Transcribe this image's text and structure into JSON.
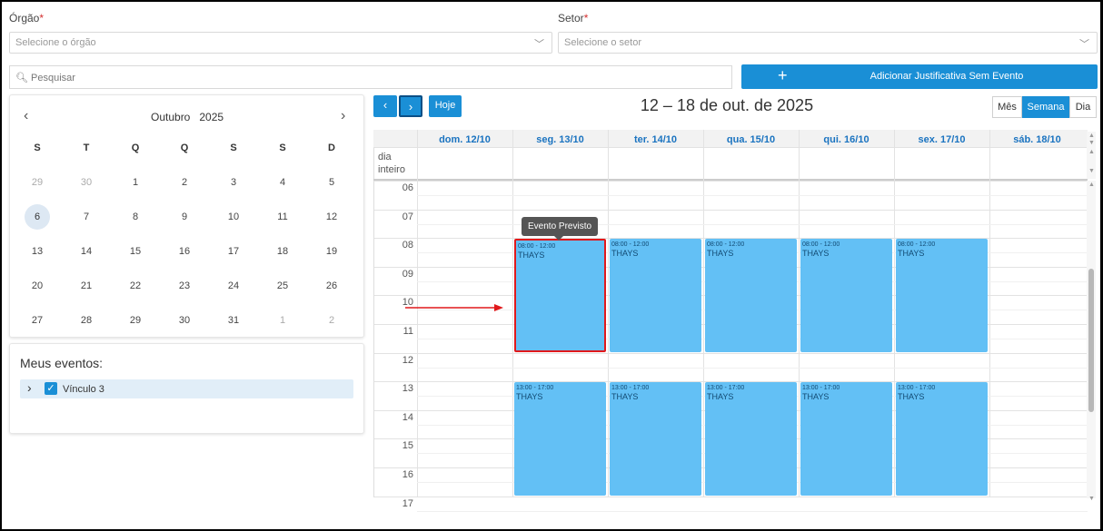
{
  "filters": {
    "orgao_label": "Órgão",
    "orgao_placeholder": "Selecione o órgão",
    "setor_label": "Setor",
    "setor_placeholder": "Selecione o setor",
    "required_mark": "*"
  },
  "search": {
    "placeholder": "Pesquisar"
  },
  "add_button": {
    "plus": "+",
    "label": "Adicionar Justificativa Sem Evento"
  },
  "mini_calendar": {
    "month": "Outubro",
    "year": "2025",
    "prev": "‹",
    "next": "›",
    "weekdays": [
      "S",
      "T",
      "Q",
      "Q",
      "S",
      "S",
      "D"
    ],
    "weeks": [
      [
        "29",
        "30",
        "1",
        "2",
        "3",
        "4",
        "5"
      ],
      [
        "6",
        "7",
        "8",
        "9",
        "10",
        "11",
        "12"
      ],
      [
        "13",
        "14",
        "15",
        "16",
        "17",
        "18",
        "19"
      ],
      [
        "20",
        "21",
        "22",
        "23",
        "24",
        "25",
        "26"
      ],
      [
        "27",
        "28",
        "29",
        "30",
        "31",
        "1",
        "2"
      ]
    ]
  },
  "meus_eventos": {
    "title": "Meus eventos:",
    "item_label": "Vínculo 3"
  },
  "toolbar": {
    "prev": "‹",
    "next": "›",
    "today": "Hoje",
    "title": "12 – 18 de out. de 2025",
    "views": [
      "Mês",
      "Semana",
      "Dia"
    ],
    "active_view": "Semana"
  },
  "week": {
    "all_day_label_1": "dia",
    "all_day_label_2": "inteiro",
    "columns": [
      "dom. 12/10",
      "seg. 13/10",
      "ter. 14/10",
      "qua. 15/10",
      "qui. 16/10",
      "sex. 17/10",
      "sáb. 18/10"
    ],
    "hours": [
      "06",
      "07",
      "08",
      "09",
      "10",
      "11",
      "12",
      "13",
      "14",
      "15",
      "16",
      "17"
    ]
  },
  "events": {
    "morning_time": "08:00 - 12:00",
    "afternoon_time": "13:00 - 17:00",
    "name": "THAYS",
    "tooltip": "Evento Previsto"
  },
  "colors": {
    "accent": "#1a8fd6",
    "event": "#63c0f5",
    "highlight": "#e0191c"
  }
}
